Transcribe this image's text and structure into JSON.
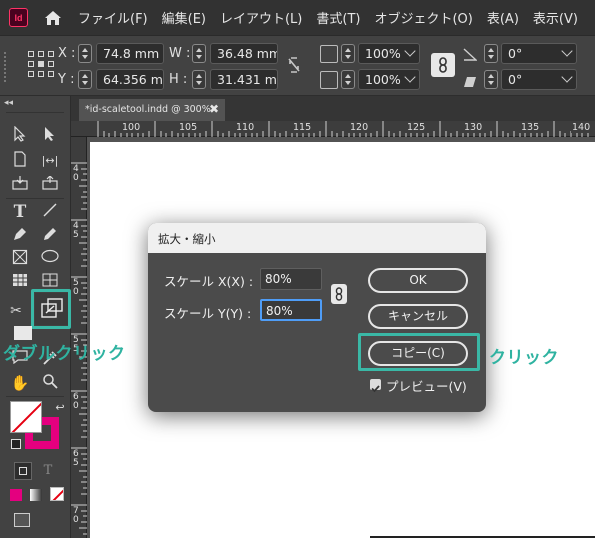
{
  "app": {
    "logo_text": "Id"
  },
  "menu": [
    "ファイル(F)",
    "編集(E)",
    "レイアウト(L)",
    "書式(T)",
    "オブジェクト(O)",
    "表(A)",
    "表示(V)"
  ],
  "control": {
    "x_label": "X :",
    "x_value": "74.8 mm",
    "y_label": "Y :",
    "y_value": "64.356 mm",
    "w_label": "W :",
    "w_value": "36.48 mm",
    "h_label": "H :",
    "h_value": "31.431 mm",
    "scale_x": "100%",
    "scale_y": "100%",
    "rotate": "0°",
    "shear": "0°"
  },
  "document_tab": {
    "title": "*id-scaletool.indd @ 300%",
    "close": "✖"
  },
  "ruler": {
    "h_ticks": [
      "100",
      "105",
      "110",
      "115",
      "120",
      "125",
      "130",
      "135",
      "140"
    ],
    "v_ticks": [
      "4 0",
      "4 5",
      "5 0",
      "5 5",
      "6 0",
      "6 5",
      "7 0"
    ]
  },
  "dialog": {
    "title": "拡大・縮小",
    "scale_x_label": "スケール X(X) :",
    "scale_x_value": "80%",
    "scale_y_label": "スケール Y(Y) :",
    "scale_y_value": "80%",
    "ok": "OK",
    "cancel": "キャンセル",
    "copy": "コピー(C)",
    "preview": "プレビュー(V)",
    "preview_checked": true
  },
  "annotations": {
    "double_click": "ダブルクリック",
    "click": "クリック",
    "color": "#3ab8a6"
  },
  "colors": {
    "accent_teal": "#3ab8a6",
    "stroke_magenta": "#e4007f"
  }
}
